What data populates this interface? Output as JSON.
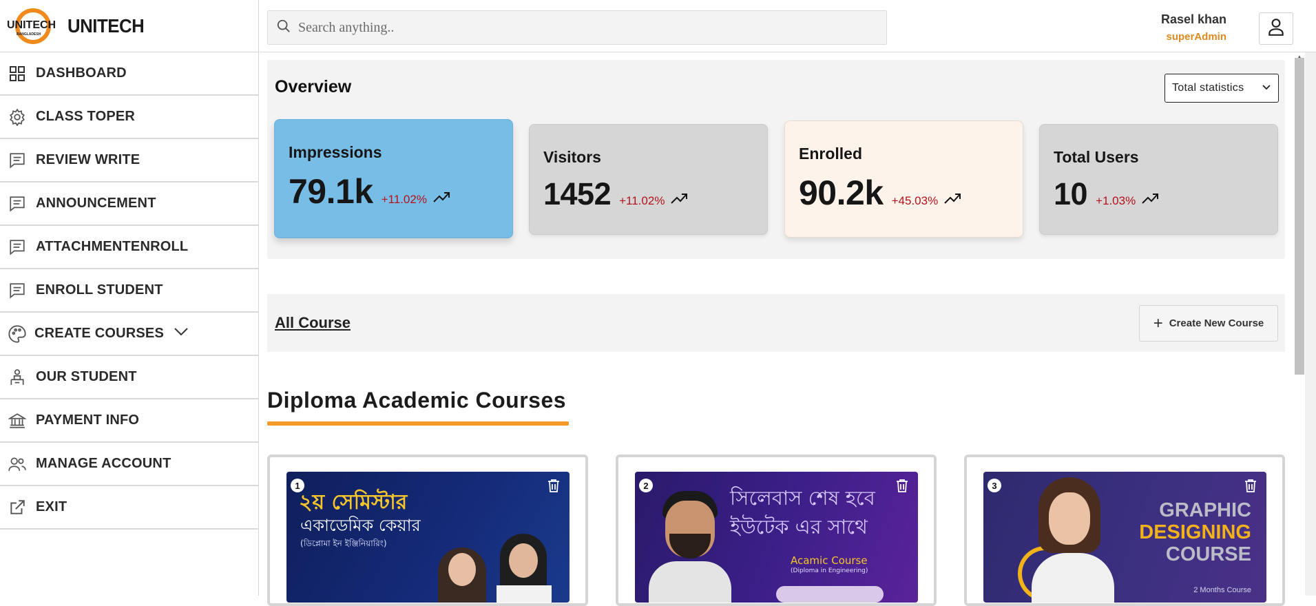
{
  "brand": {
    "name": "UNITECH",
    "logo_text": "UNITECH",
    "logo_subtext": "BANGLADESH"
  },
  "sidebar": {
    "items": [
      {
        "label": "DASHBOARD",
        "icon": "dashboard-grid-icon"
      },
      {
        "label": "CLASS TOPER",
        "icon": "gear-icon"
      },
      {
        "label": "REVIEW WRITE",
        "icon": "message-icon"
      },
      {
        "label": "ANNOUNCEMENT",
        "icon": "message-icon"
      },
      {
        "label": "ATTACHMENTENROLL",
        "icon": "message-icon"
      },
      {
        "label": "ENROLL STUDENT",
        "icon": "message-icon"
      },
      {
        "label": "CREATE COURSES",
        "icon": "palette-icon"
      },
      {
        "label": "OUR STUDENT",
        "icon": "student-desk-icon"
      },
      {
        "label": "PAYMENT INFO",
        "icon": "bank-icon"
      },
      {
        "label": "MANAGE ACCOUNT",
        "icon": "users-icon"
      },
      {
        "label": "EXIT",
        "icon": "external-link-icon"
      }
    ]
  },
  "search": {
    "placeholder": "Search anything..",
    "value": ""
  },
  "user": {
    "name": "Rasel khan",
    "role": "superAdmin"
  },
  "overview": {
    "title": "Overview",
    "filter": "Total statistics",
    "cards": [
      {
        "label": "Impressions",
        "value": "79.1k",
        "delta": "+11.02%"
      },
      {
        "label": "Visitors",
        "value": "1452",
        "delta": "+11.02%"
      },
      {
        "label": "Enrolled",
        "value": "90.2k",
        "delta": "+45.03%"
      },
      {
        "label": "Total Users",
        "value": "10",
        "delta": "+1.03%"
      }
    ]
  },
  "courses_bar": {
    "link": "All Course",
    "create_label": "Create New Course"
  },
  "section": {
    "title": "Diploma Academic Courses"
  },
  "courses": [
    {
      "num": "1",
      "line1": "২য় সেমিস্টার",
      "line2": "একাডেমিক কেয়ার",
      "line3": "(ডিপ্লোমা ইন ইঞ্জিনিয়ারিং)"
    },
    {
      "num": "2",
      "line1": "সিলেবাস শেষ হবে",
      "line2": "ইউটেক এর সাথে",
      "line3": "Acamic Course",
      "line4": "(Diploma in Engineering)"
    },
    {
      "num": "3",
      "line1": "GRAPHIC",
      "line2": "DESIGNING",
      "line3": "COURSE",
      "line4": "2 Months Course"
    }
  ],
  "colors": {
    "accent": "#f39b26",
    "role": "#e08a1e",
    "delta": "#b3121d",
    "impressions_bg": "#78bde6",
    "enrolled_bg": "#fef3ea",
    "neutral_card": "#d6d6d6"
  }
}
